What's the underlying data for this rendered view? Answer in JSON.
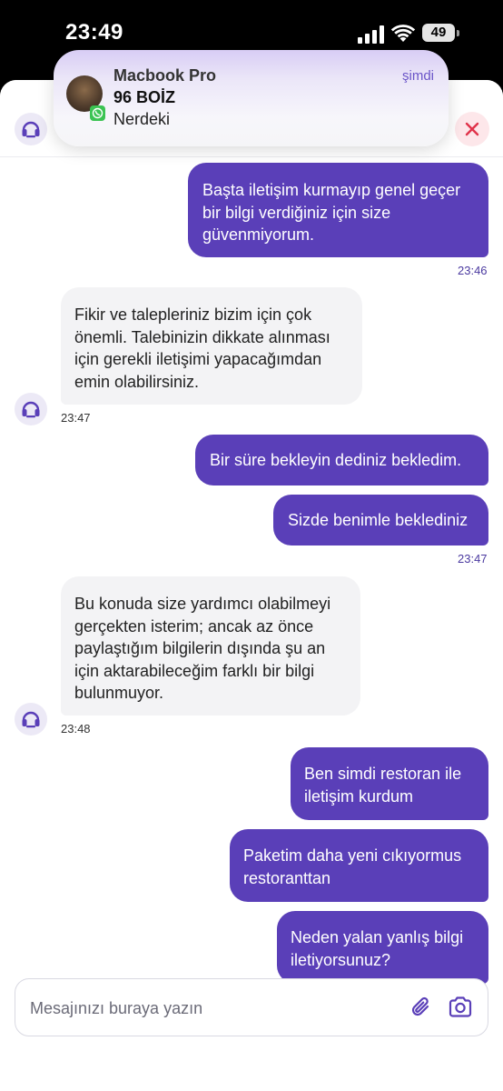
{
  "status_bar": {
    "time": "23:49",
    "battery": "49"
  },
  "notification": {
    "device": "Macbook Pro",
    "time": "şimdi",
    "title": "96 BOİZ",
    "body": "Nerdeki"
  },
  "messages": [
    {
      "dir": "out",
      "lines": [
        "Başta iletişim kurmayıp genel geçer",
        "bir bilgi verdiğiniz için size",
        "güvenmiyorum."
      ]
    },
    {
      "dir": "in",
      "lines": [
        "Fikir ve talepleriniz bizim için çok",
        "önemli. Talebinizin dikkate alınması",
        "için gerekli iletişimi yapacağımdan",
        "emin olabilirsiniz."
      ]
    },
    {
      "dir": "out",
      "lines": [
        "Bir süre bekleyin dediniz bekledim."
      ]
    },
    {
      "dir": "out",
      "lines": [
        "Sizde benimle beklediniz"
      ]
    },
    {
      "dir": "in",
      "lines": [
        "Bu konuda size yardımcı olabilmeyi",
        "gerçekten isterim; ancak az önce",
        "paylaştığım bilgilerin dışında şu an",
        "için aktarabileceğim farklı bir bilgi",
        "bulunmuyor."
      ]
    },
    {
      "dir": "out",
      "lines": [
        "Ben simdi restoran ile",
        "iletişim kurdum"
      ]
    },
    {
      "dir": "out",
      "lines": [
        "Paketim daha yeni cıkıyormus",
        "restoranttan"
      ]
    },
    {
      "dir": "out",
      "lines": [
        "Neden yalan yanlış bilgi",
        "iletiyorsunuz?"
      ]
    }
  ],
  "timestamps": [
    "23:46",
    "23:47",
    "23:47",
    "23:48"
  ],
  "composer": {
    "placeholder": "Mesajınızı buraya yazın"
  },
  "icons": {
    "header_avatar": "headset-icon",
    "close": "close-icon",
    "attach": "paperclip-icon",
    "camera": "camera-icon",
    "notif_badge": "whatsapp-icon"
  },
  "colors": {
    "accent": "#5a3fb8",
    "incoming_bubble": "#f3f3f5",
    "close": "#e0334a"
  }
}
